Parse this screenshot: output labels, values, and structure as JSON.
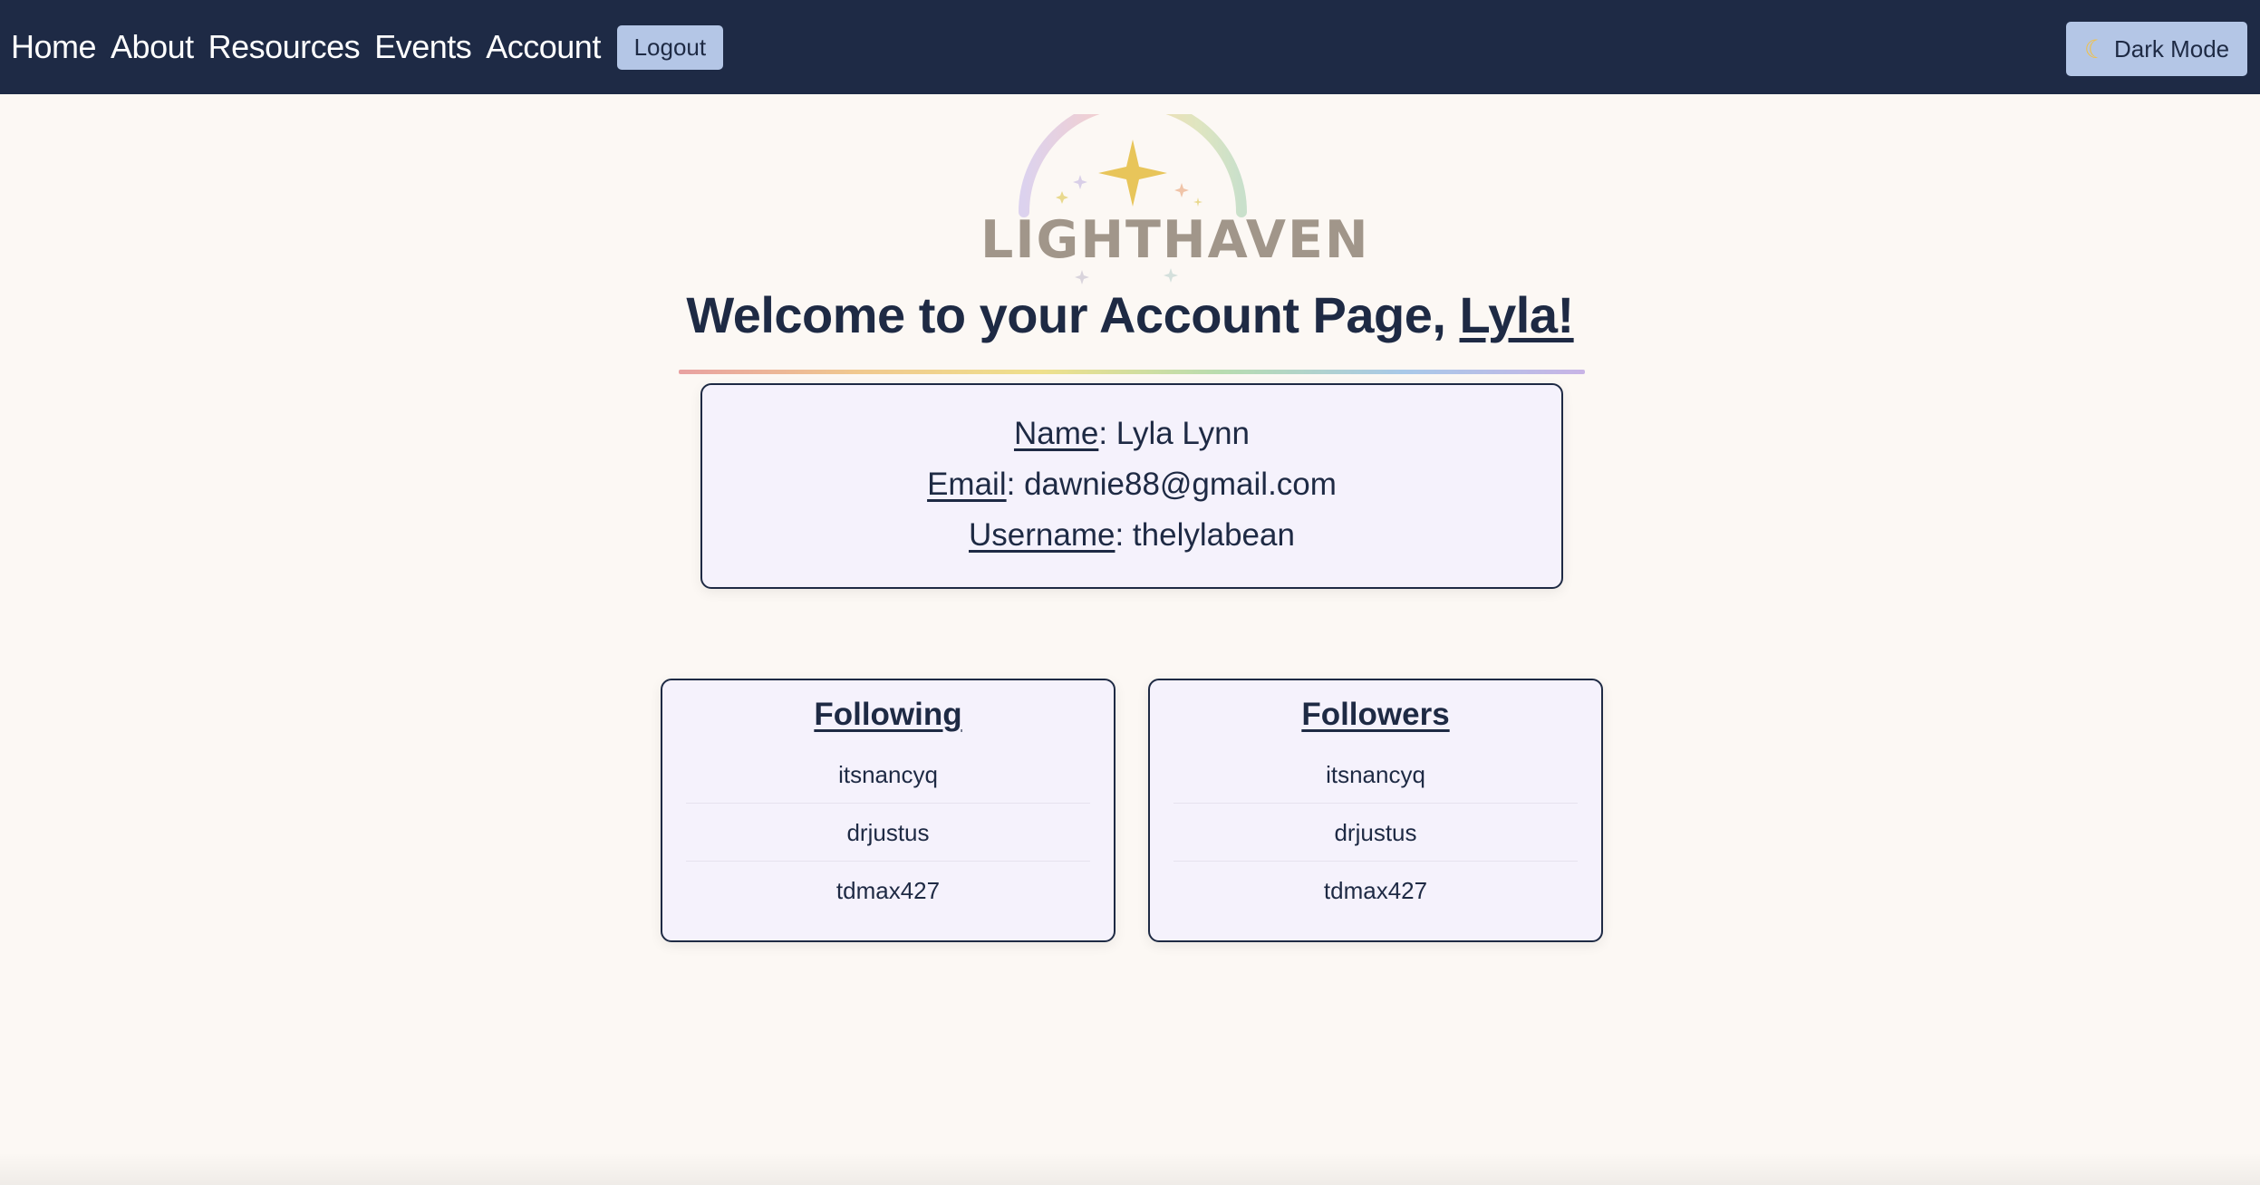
{
  "nav": {
    "links": [
      "Home",
      "About",
      "Resources",
      "Events",
      "Account"
    ],
    "logout_label": "Logout",
    "dark_mode_label": "Dark Mode",
    "dark_mode_icon": "moon-icon"
  },
  "logo": {
    "text": "LIGHTHAVEN",
    "colors": {
      "text": "#a1968a",
      "star": "#e8c55a"
    }
  },
  "welcome": {
    "prefix": "Welcome to your Account Page, ",
    "name": "Lyla!"
  },
  "account": {
    "name_label": "Name",
    "name_value": "Lyla Lynn",
    "email_label": "Email",
    "email_value": "dawnie88@gmail.com",
    "username_label": "Username",
    "username_value": "thelylabean"
  },
  "following": {
    "title": "Following",
    "items": [
      "itsnancyq",
      "drjustus",
      "tdmax427"
    ]
  },
  "followers": {
    "title": "Followers",
    "items": [
      "itsnancyq",
      "drjustus",
      "tdmax427"
    ]
  },
  "colors": {
    "navbar": "#1e2a45",
    "button": "#b4c6e6",
    "card_bg": "#f5f2fc",
    "page_bg": "#fcf8f4",
    "text": "#1e2a44"
  }
}
